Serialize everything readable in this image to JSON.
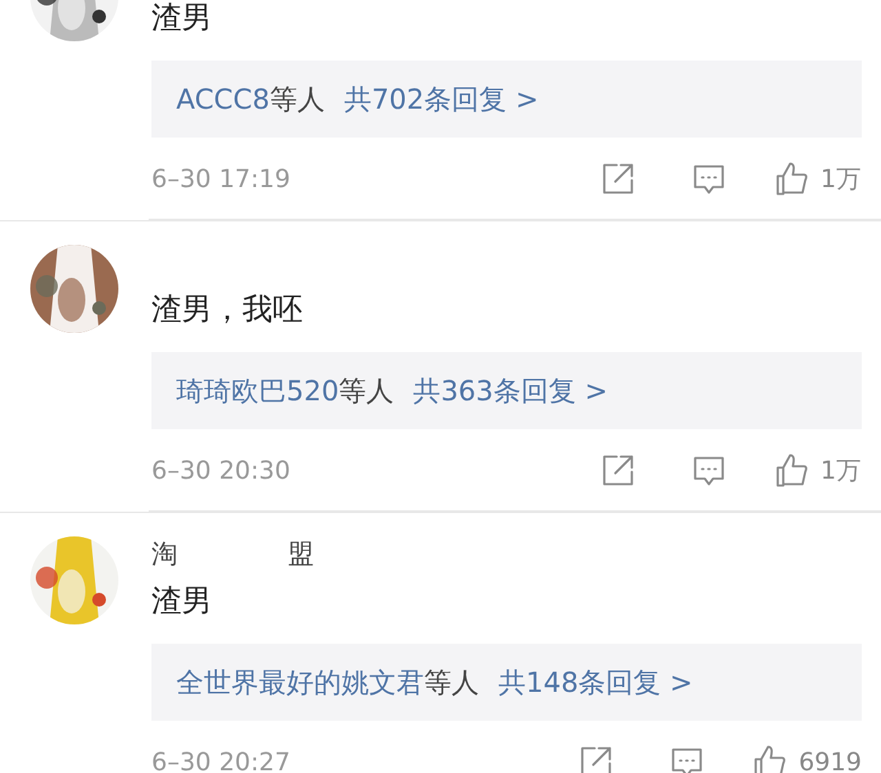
{
  "comments": [
    {
      "avatar": {
        "kind": "picture"
      },
      "text": "渣男",
      "replies": {
        "users": "ACCC8",
        "suffix": "等人",
        "count": "共702条回复 >"
      },
      "time": "6–30 17:19",
      "likes": "1万"
    },
    {
      "avatar": {
        "kind": "picture"
      },
      "text": "渣男，我呸",
      "replies": {
        "users": "琦琦欧巴520",
        "suffix": "等人",
        "count": "共363条回复 >"
      },
      "time": "6–30 20:30",
      "likes": "1万"
    },
    {
      "avatar": {
        "kind": "picture"
      },
      "username_parts": [
        "淘",
        "盟"
      ],
      "text": "渣男",
      "replies": {
        "users": "全世界最好的姚文君",
        "suffix": "等人",
        "count": "共148条回复 >"
      },
      "time": "6–30 20:27",
      "likes": "6919"
    }
  ]
}
